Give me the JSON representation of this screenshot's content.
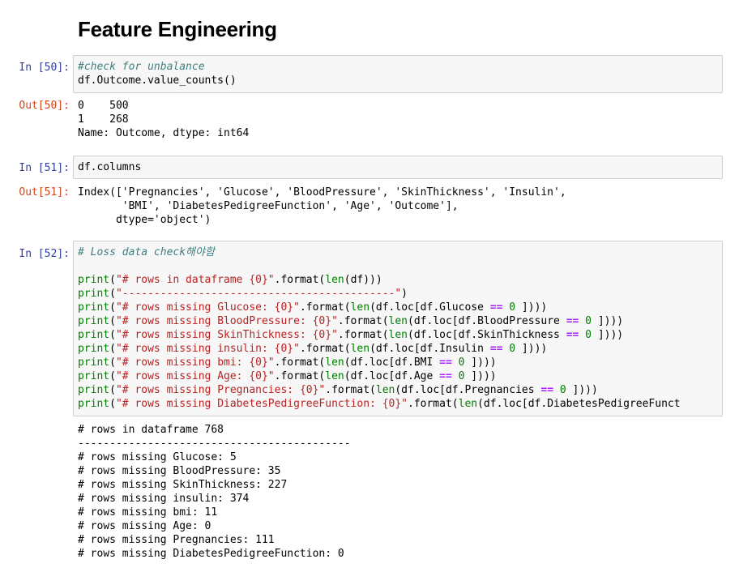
{
  "heading": "Feature Engineering",
  "cells": [
    {
      "in_prompt": "In [50]:",
      "out_prompt": "Out[50]:",
      "code": [
        [
          {
            "t": "comment",
            "v": "#check for unbalance"
          }
        ],
        [
          {
            "t": "plain",
            "v": "df.Outcome.value_counts()"
          }
        ]
      ],
      "output": [
        "0    500",
        "1    268",
        "Name: Outcome, dtype: int64"
      ]
    },
    {
      "in_prompt": "In [51]:",
      "out_prompt": "Out[51]:",
      "code": [
        [
          {
            "t": "plain",
            "v": "df.columns"
          }
        ]
      ],
      "output": [
        "Index(['Pregnancies', 'Glucose', 'BloodPressure', 'SkinThickness', 'Insulin',",
        "       'BMI', 'DiabetesPedigreeFunction', 'Age', 'Outcome'],",
        "      dtype='object')"
      ]
    },
    {
      "in_prompt": "In [52]:",
      "code": [
        [
          {
            "t": "comment",
            "v": "# Loss data check해야함"
          }
        ],
        [],
        [
          {
            "t": "builtin",
            "v": "print"
          },
          {
            "t": "plain",
            "v": "("
          },
          {
            "t": "string",
            "v": "\"# rows in dataframe {0}\""
          },
          {
            "t": "plain",
            "v": ".format("
          },
          {
            "t": "builtin",
            "v": "len"
          },
          {
            "t": "plain",
            "v": "(df)))"
          }
        ],
        [
          {
            "t": "builtin",
            "v": "print"
          },
          {
            "t": "plain",
            "v": "("
          },
          {
            "t": "string",
            "v": "\"-------------------------------------------\""
          },
          {
            "t": "plain",
            "v": ")"
          }
        ],
        [
          {
            "t": "builtin",
            "v": "print"
          },
          {
            "t": "plain",
            "v": "("
          },
          {
            "t": "string",
            "v": "\"# rows missing Glucose: {0}\""
          },
          {
            "t": "plain",
            "v": ".format("
          },
          {
            "t": "builtin",
            "v": "len"
          },
          {
            "t": "plain",
            "v": "(df.loc[df.Glucose "
          },
          {
            "t": "op",
            "v": "=="
          },
          {
            "t": "plain",
            "v": " "
          },
          {
            "t": "num",
            "v": "0"
          },
          {
            "t": "plain",
            "v": " ])))"
          }
        ],
        [
          {
            "t": "builtin",
            "v": "print"
          },
          {
            "t": "plain",
            "v": "("
          },
          {
            "t": "string",
            "v": "\"# rows missing BloodPressure: {0}\""
          },
          {
            "t": "plain",
            "v": ".format("
          },
          {
            "t": "builtin",
            "v": "len"
          },
          {
            "t": "plain",
            "v": "(df.loc[df.BloodPressure "
          },
          {
            "t": "op",
            "v": "=="
          },
          {
            "t": "plain",
            "v": " "
          },
          {
            "t": "num",
            "v": "0"
          },
          {
            "t": "plain",
            "v": " ])))"
          }
        ],
        [
          {
            "t": "builtin",
            "v": "print"
          },
          {
            "t": "plain",
            "v": "("
          },
          {
            "t": "string",
            "v": "\"# rows missing SkinThickness: {0}\""
          },
          {
            "t": "plain",
            "v": ".format("
          },
          {
            "t": "builtin",
            "v": "len"
          },
          {
            "t": "plain",
            "v": "(df.loc[df.SkinThickness "
          },
          {
            "t": "op",
            "v": "=="
          },
          {
            "t": "plain",
            "v": " "
          },
          {
            "t": "num",
            "v": "0"
          },
          {
            "t": "plain",
            "v": " ])))"
          }
        ],
        [
          {
            "t": "builtin",
            "v": "print"
          },
          {
            "t": "plain",
            "v": "("
          },
          {
            "t": "string",
            "v": "\"# rows missing insulin: {0}\""
          },
          {
            "t": "plain",
            "v": ".format("
          },
          {
            "t": "builtin",
            "v": "len"
          },
          {
            "t": "plain",
            "v": "(df.loc[df.Insulin "
          },
          {
            "t": "op",
            "v": "=="
          },
          {
            "t": "plain",
            "v": " "
          },
          {
            "t": "num",
            "v": "0"
          },
          {
            "t": "plain",
            "v": " ])))"
          }
        ],
        [
          {
            "t": "builtin",
            "v": "print"
          },
          {
            "t": "plain",
            "v": "("
          },
          {
            "t": "string",
            "v": "\"# rows missing bmi: {0}\""
          },
          {
            "t": "plain",
            "v": ".format("
          },
          {
            "t": "builtin",
            "v": "len"
          },
          {
            "t": "plain",
            "v": "(df.loc[df.BMI "
          },
          {
            "t": "op",
            "v": "=="
          },
          {
            "t": "plain",
            "v": " "
          },
          {
            "t": "num",
            "v": "0"
          },
          {
            "t": "plain",
            "v": " ])))"
          }
        ],
        [
          {
            "t": "builtin",
            "v": "print"
          },
          {
            "t": "plain",
            "v": "("
          },
          {
            "t": "string",
            "v": "\"# rows missing Age: {0}\""
          },
          {
            "t": "plain",
            "v": ".format("
          },
          {
            "t": "builtin",
            "v": "len"
          },
          {
            "t": "plain",
            "v": "(df.loc[df.Age "
          },
          {
            "t": "op",
            "v": "=="
          },
          {
            "t": "plain",
            "v": " "
          },
          {
            "t": "num",
            "v": "0"
          },
          {
            "t": "plain",
            "v": " ])))"
          }
        ],
        [
          {
            "t": "builtin",
            "v": "print"
          },
          {
            "t": "plain",
            "v": "("
          },
          {
            "t": "string",
            "v": "\"# rows missing Pregnancies: {0}\""
          },
          {
            "t": "plain",
            "v": ".format("
          },
          {
            "t": "builtin",
            "v": "len"
          },
          {
            "t": "plain",
            "v": "(df.loc[df.Pregnancies "
          },
          {
            "t": "op",
            "v": "=="
          },
          {
            "t": "plain",
            "v": " "
          },
          {
            "t": "num",
            "v": "0"
          },
          {
            "t": "plain",
            "v": " ])))"
          }
        ],
        [
          {
            "t": "builtin",
            "v": "print"
          },
          {
            "t": "plain",
            "v": "("
          },
          {
            "t": "string",
            "v": "\"# rows missing DiabetesPedigreeFunction: {0}\""
          },
          {
            "t": "plain",
            "v": ".format("
          },
          {
            "t": "builtin",
            "v": "len"
          },
          {
            "t": "plain",
            "v": "(df.loc[df.DiabetesPedigreeFunct"
          }
        ]
      ],
      "output": [
        "# rows in dataframe 768",
        "-------------------------------------------",
        "# rows missing Glucose: 5",
        "# rows missing BloodPressure: 35",
        "# rows missing SkinThickness: 227",
        "# rows missing insulin: 374",
        "# rows missing bmi: 11",
        "# rows missing Age: 0",
        "# rows missing Pregnancies: 111",
        "# rows missing DiabetesPedigreeFunction: 0"
      ]
    }
  ]
}
